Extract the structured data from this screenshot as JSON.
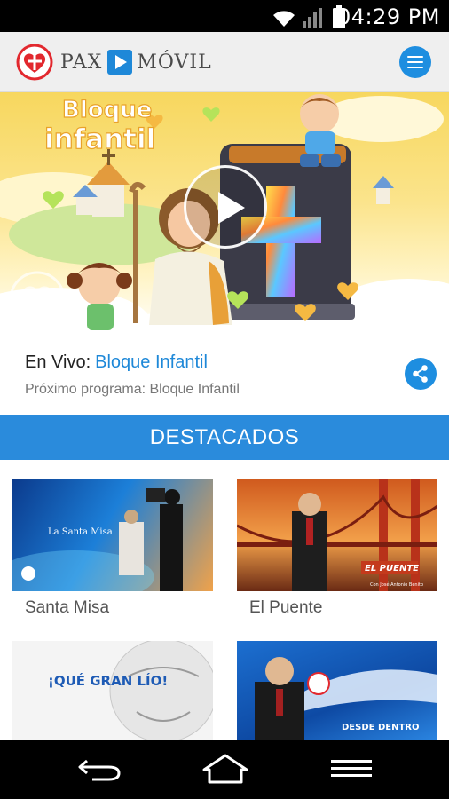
{
  "status_bar": {
    "time": "04:29 PM",
    "icons": [
      "wifi-icon",
      "signal-icon",
      "battery-icon"
    ]
  },
  "app_bar": {
    "logo_word_1": "PAX",
    "logo_word_2": "MÓVIL",
    "menu_icon": "hamburger-menu-icon"
  },
  "hero": {
    "title_line_1": "Bloque",
    "title_line_2": "infantil",
    "play_icon": "play-icon"
  },
  "now_playing": {
    "live_label": "En Vivo:",
    "live_program": "Bloque Infantil",
    "next_label": "Próximo programa: Bloque Infantil",
    "share_icon": "share-icon"
  },
  "featured": {
    "header": "DESTACADOS",
    "items": [
      {
        "title": "Santa Misa",
        "thumb_caption": "La Santa Misa"
      },
      {
        "title": "El Puente",
        "thumb_caption": "EL PUENTE",
        "thumb_subcaption": "Con José Antonio Benito"
      },
      {
        "title": "",
        "thumb_caption": "¡QUÉ GRAN LÍO!"
      },
      {
        "title": "",
        "thumb_caption": "DESDE DENTRO"
      }
    ]
  },
  "nav_bar": {
    "icons": [
      "back-icon",
      "home-icon",
      "recents-icon"
    ]
  },
  "colors": {
    "accent": "#1e88d8",
    "section_header": "#2a8bdc",
    "status_bar": "#000000",
    "app_bar": "#efefef"
  }
}
